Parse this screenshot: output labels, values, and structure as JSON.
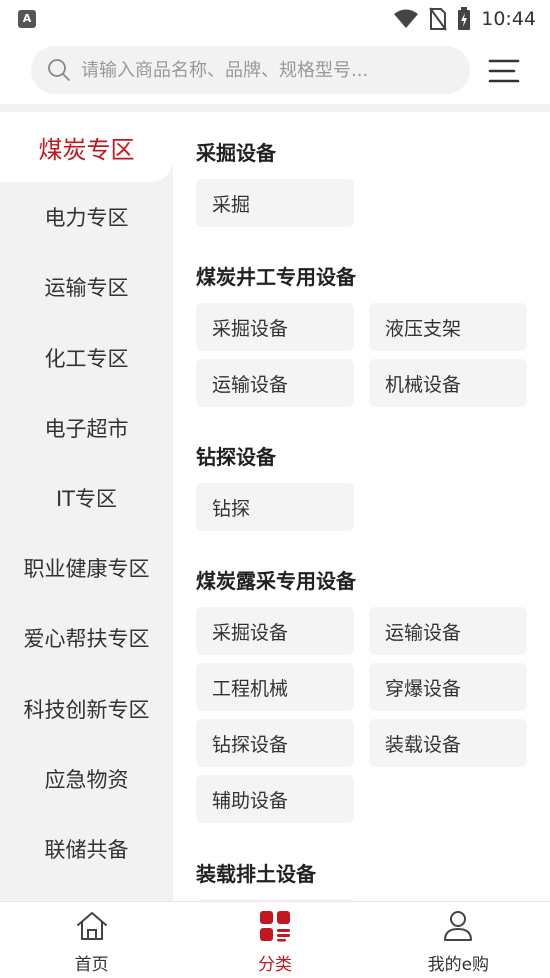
{
  "status_bar": {
    "time": "10:44",
    "app_icon_letter": "A"
  },
  "search": {
    "placeholder": "请输入商品名称、品牌、规格型号..."
  },
  "sidebar": {
    "items": [
      {
        "label": "煤炭专区",
        "active": true
      },
      {
        "label": "电力专区"
      },
      {
        "label": "运输专区"
      },
      {
        "label": "化工专区"
      },
      {
        "label": "电子超市"
      },
      {
        "label": "IT专区"
      },
      {
        "label": "职业健康专区"
      },
      {
        "label": "爱心帮扶专区"
      },
      {
        "label": "科技创新专区"
      },
      {
        "label": "应急物资"
      },
      {
        "label": "联储共备"
      }
    ]
  },
  "sections": [
    {
      "title": "采掘设备",
      "chips": [
        "采掘"
      ]
    },
    {
      "title": "煤炭井工专用设备",
      "chips": [
        "采掘设备",
        "液压支架",
        "运输设备",
        "机械设备"
      ]
    },
    {
      "title": "钻探设备",
      "chips": [
        "钻探"
      ]
    },
    {
      "title": "煤炭露采专用设备",
      "chips": [
        "采掘设备",
        "运输设备",
        "工程机械",
        "穿爆设备",
        "钻探设备",
        "装载设备",
        "辅助设备"
      ]
    },
    {
      "title": "装载排土设备",
      "chips": []
    }
  ],
  "tabbar": {
    "tabs": [
      {
        "label": "首页",
        "icon": "home-icon"
      },
      {
        "label": "分类",
        "icon": "category-icon",
        "active": true
      },
      {
        "label": "我的e购",
        "icon": "user-icon"
      }
    ]
  },
  "colors": {
    "accent": "#c2171e",
    "sidebar_bg": "#f2f2f2",
    "chip_bg": "#f4f4f4"
  }
}
